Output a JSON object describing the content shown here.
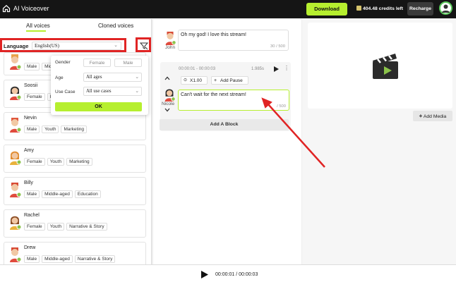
{
  "topbar": {
    "title": "AI Voiceover",
    "download_label": "Download",
    "credits": "404.48 credits left",
    "recharge_label": "Recharge"
  },
  "tabs": {
    "all": "All voices",
    "cloned": "Cloned voices"
  },
  "language": {
    "label": "Language",
    "value": "English(US)"
  },
  "voices": [
    {
      "name": "",
      "tags": [
        "Male",
        "Mid"
      ]
    },
    {
      "name": "Soosii",
      "tags": [
        "Female",
        "Be"
      ]
    },
    {
      "name": "Nevin",
      "tags": [
        "Male",
        "Youth",
        "Marketing"
      ]
    },
    {
      "name": "Amy",
      "tags": [
        "Female",
        "Youth",
        "Marketing"
      ]
    },
    {
      "name": "Billy",
      "tags": [
        "Male",
        "Middle-aged",
        "Education"
      ]
    },
    {
      "name": "Rachel",
      "tags": [
        "Female",
        "Youth",
        "Narrative & Story"
      ]
    },
    {
      "name": "Drew",
      "tags": [
        "Male",
        "Middle-aged",
        "Narrative & Story"
      ]
    }
  ],
  "filter": {
    "gender_label": "Gender",
    "female": "Female",
    "male": "Male",
    "age_label": "Age",
    "age_value": "All ages",
    "usecase_label": "Use Case",
    "usecase_value": "All use cases",
    "ok_label": "OK"
  },
  "blocks": [
    {
      "speaker": "John",
      "text": "Oh my god! I love this stream!",
      "count": "30 / 500"
    },
    {
      "speaker": "Nicole",
      "time": "00:00:01 - 00:00:03",
      "duration": "1.985s",
      "speed": "X1.00",
      "pause": "Add Pause",
      "text": "Can't wait for the next stream!",
      "count": "/ 500"
    }
  ],
  "add_block_label": "Add A Block",
  "add_media_label": "Add Media",
  "player": {
    "time": "00:00:01 / 00:00:03"
  },
  "colors": {
    "accent": "#b6ef2f",
    "highlight": "#e02424"
  }
}
